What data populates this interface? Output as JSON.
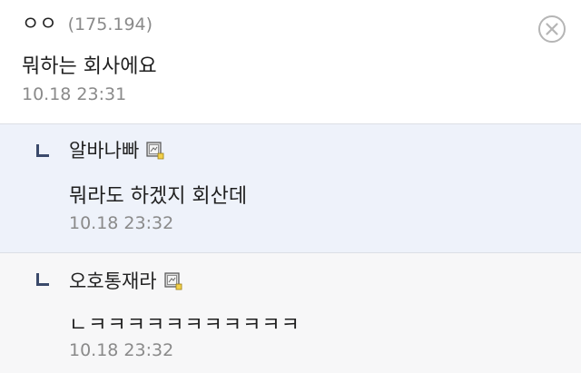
{
  "comment": {
    "author": "ㅇㅇ",
    "ip": "(175.194)",
    "text": "뭐하는 회사에요",
    "time": "10.18 23:31"
  },
  "replies": [
    {
      "author": "알바나빠",
      "text": "뭐라도 하겠지 회산데",
      "time": "10.18 23:32",
      "icon": "gallery-member-icon"
    },
    {
      "author": "오호통재라",
      "text": "ㄴㅋㅋㅋㅋㅋㅋㅋㅋㅋㅋㅋ",
      "time": "10.18 23:32",
      "icon": "gallery-member-icon"
    }
  ],
  "icons": {
    "close": "close-circle-icon",
    "reply": "reply-arrow-icon"
  },
  "colors": {
    "reply_highlight_bg": "#eef2fa",
    "reply_bg": "#f7f7f8",
    "reply_arrow": "#3b4a6b",
    "muted_text": "#8a8a8a"
  }
}
